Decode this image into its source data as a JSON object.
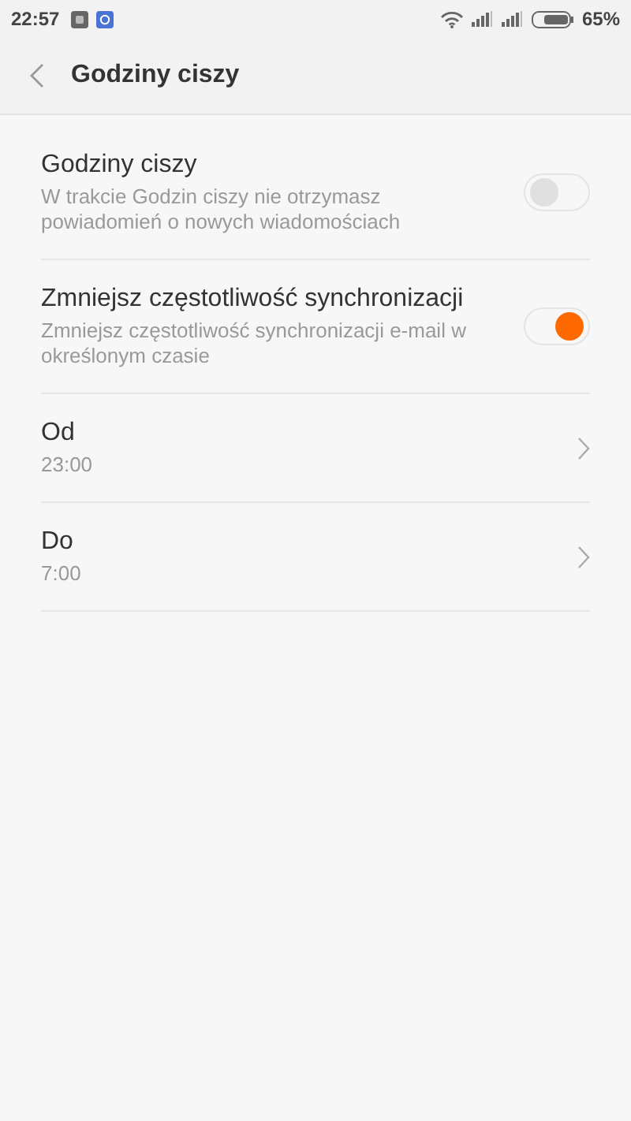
{
  "status_bar": {
    "time": "22:57",
    "battery_text": "65%"
  },
  "header": {
    "title": "Godziny ciszy"
  },
  "settings": [
    {
      "kind": "toggle",
      "title": "Godziny ciszy",
      "subtitle": "W trakcie Godzin ciszy nie otrzymasz powiadomień o nowych wiadomościach",
      "on": false
    },
    {
      "kind": "toggle",
      "title": "Zmniejsz częstotliwość synchronizacji",
      "subtitle": "Zmniejsz częstotliwość synchronizacji e-mail w określonym czasie",
      "on": true
    },
    {
      "kind": "link",
      "title": "Od",
      "subtitle": "23:00"
    },
    {
      "kind": "link",
      "title": "Do",
      "subtitle": "7:00"
    }
  ]
}
